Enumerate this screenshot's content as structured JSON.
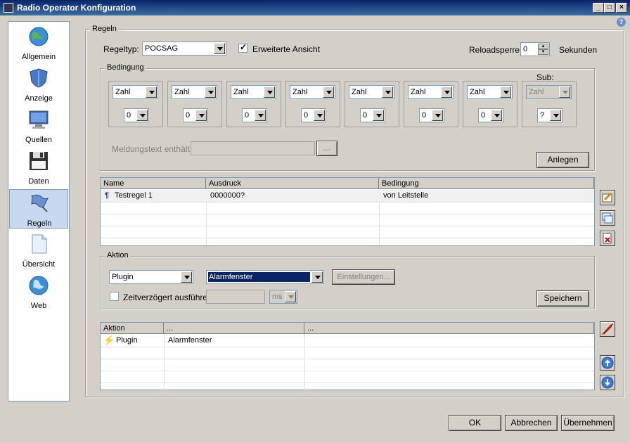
{
  "window": {
    "title": "Radio Operator Konfiguration"
  },
  "sidebar": {
    "items": [
      {
        "label": "Allgemein",
        "icon": "globe-icon"
      },
      {
        "label": "Anzeige",
        "icon": "shield-icon"
      },
      {
        "label": "Quellen",
        "icon": "monitor-icon"
      },
      {
        "label": "Daten",
        "icon": "floppy-icon"
      },
      {
        "label": "Regeln",
        "icon": "flag-icon",
        "selected": true
      },
      {
        "label": "Übersicht",
        "icon": "page-icon"
      },
      {
        "label": "Web",
        "icon": "globe-icon"
      }
    ]
  },
  "regeln": {
    "group_label": "Regeln",
    "regeltyp_label": "Regeltyp:",
    "regeltyp_value": "POCSAG",
    "erweiterte_label": "Erweiterte Ansicht",
    "erweiterte_checked": true,
    "reload_label": "Reloadsperre:",
    "reload_value": "0",
    "sekunden_label": "Sekunden"
  },
  "bedingung": {
    "group_label": "Bedingung",
    "sub_label": "Sub:",
    "columns": [
      {
        "type": "Zahl",
        "value": "0"
      },
      {
        "type": "Zahl",
        "value": "0"
      },
      {
        "type": "Zahl",
        "value": "0"
      },
      {
        "type": "Zahl",
        "value": "0"
      },
      {
        "type": "Zahl",
        "value": "0"
      },
      {
        "type": "Zahl",
        "value": "0"
      },
      {
        "type": "Zahl",
        "value": "0"
      },
      {
        "type": "Zahl",
        "value": "?"
      }
    ],
    "meldung_label": "Meldungstext enthält:",
    "browse_label": "...",
    "anlegen_label": "Anlegen"
  },
  "rules_table": {
    "headers": [
      "Name",
      "Ausdruck",
      "Bedingung"
    ],
    "rows": [
      [
        "Testregel 1",
        "0000000?",
        "von Leitstelle"
      ]
    ]
  },
  "aktion": {
    "group_label": "Aktion",
    "plugin_value": "Plugin",
    "target_value": "Alarmfenster",
    "einstellungen_label": "Einstellungen...",
    "zeit_label": "Zeitverzögert ausführen",
    "unit_value": "ms",
    "speichern_label": "Speichern"
  },
  "actions_table": {
    "headers": [
      "Aktion",
      "...",
      "..."
    ],
    "rows": [
      [
        "Plugin",
        "Alarmfenster",
        ""
      ]
    ]
  },
  "footer": {
    "ok": "OK",
    "cancel": "Abbrechen",
    "apply": "Übernehmen"
  }
}
